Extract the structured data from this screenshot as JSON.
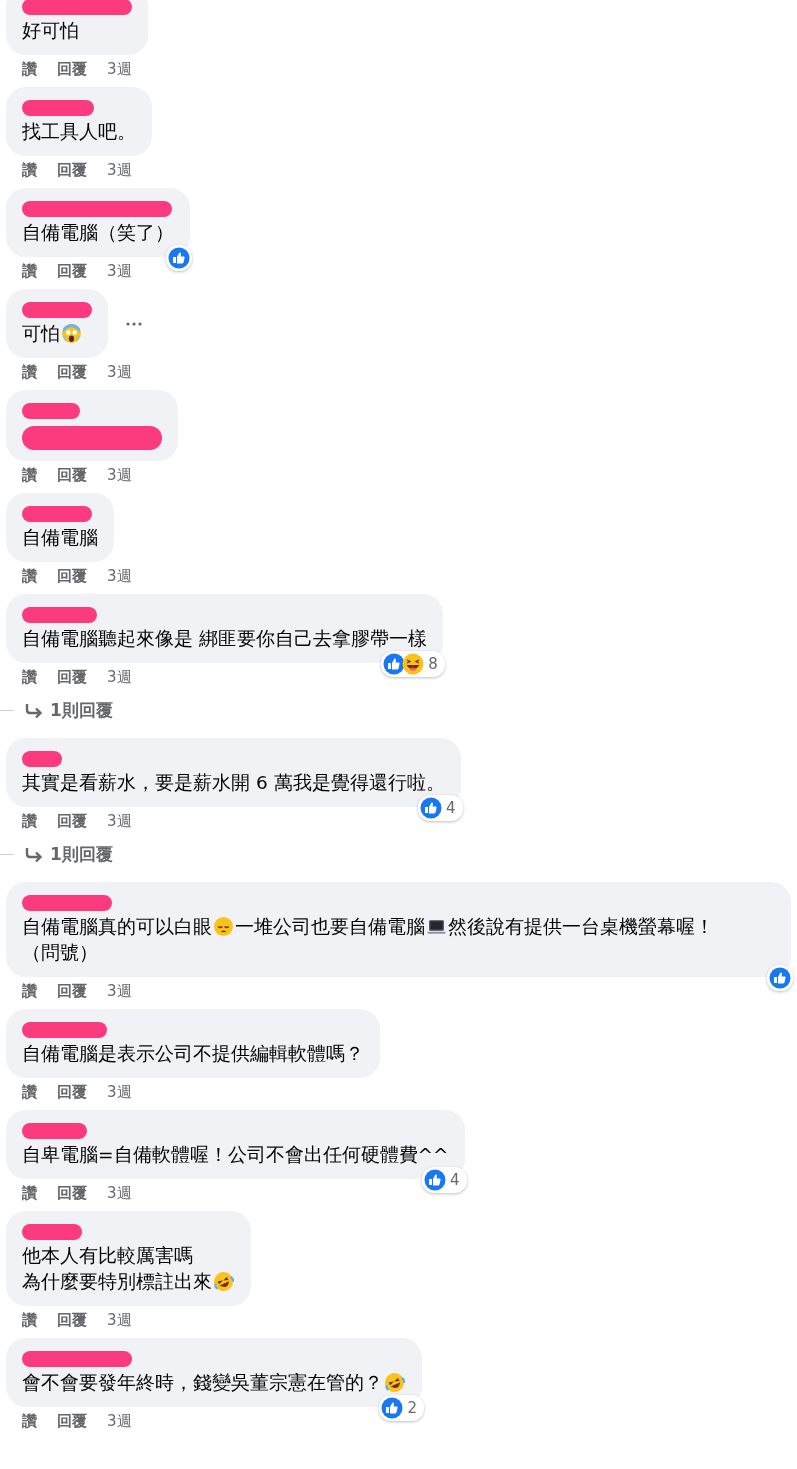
{
  "comments": [
    {
      "parts": [
        {
          "kind": "text",
          "text": "好可怕"
        }
      ],
      "like_label": "讚",
      "reply_label": "回覆",
      "time": "3週"
    },
    {
      "parts": [
        {
          "kind": "text",
          "text": "找工具人吧。"
        }
      ],
      "like_label": "讚",
      "reply_label": "回覆",
      "time": "3週"
    },
    {
      "parts": [
        {
          "kind": "text",
          "text": "自備電腦（笑了）"
        }
      ],
      "reactions": {
        "types": [
          {
            "kind": "like"
          }
        ]
      },
      "like_label": "讚",
      "reply_label": "回覆",
      "time": "3週"
    },
    {
      "parts": [
        {
          "kind": "text",
          "text": "可怕"
        },
        {
          "kind": "scream"
        }
      ],
      "menu_button": true,
      "like_label": "讚",
      "reply_label": "回覆",
      "time": "3週"
    },
    {
      "body_redacted": true,
      "like_label": "讚",
      "reply_label": "回覆",
      "time": "3週"
    },
    {
      "parts": [
        {
          "kind": "text",
          "text": "自備電腦"
        }
      ],
      "like_label": "讚",
      "reply_label": "回覆",
      "time": "3週"
    },
    {
      "parts": [
        {
          "kind": "text",
          "text": "自備電腦聽起來像是 綁匪要你自己去拿膠帶一樣"
        }
      ],
      "reactions": {
        "types": [
          {
            "kind": "like"
          },
          {
            "kind": "haha"
          }
        ],
        "count": "8"
      },
      "like_label": "讚",
      "reply_label": "回覆",
      "time": "3週",
      "replies_link": "1則回覆"
    },
    {
      "parts": [
        {
          "kind": "text",
          "text": "其實是看薪水，要是薪水開 6 萬我是覺得還行啦。"
        }
      ],
      "reactions": {
        "types": [
          {
            "kind": "like"
          }
        ],
        "count": "4"
      },
      "like_label": "讚",
      "reply_label": "回覆",
      "time": "3週",
      "replies_link": "1則回覆"
    },
    {
      "parts": [
        {
          "kind": "text",
          "text": "自備電腦真的可以白眼"
        },
        {
          "kind": "pensive"
        },
        {
          "kind": "text",
          "text": "一堆公司也要自備電腦"
        },
        {
          "kind": "laptop"
        },
        {
          "kind": "text",
          "text": "然後說有提供一台桌機螢幕喔！（問號）"
        }
      ],
      "reactions": {
        "types": [
          {
            "kind": "like"
          }
        ]
      },
      "like_label": "讚",
      "reply_label": "回覆",
      "time": "3週"
    },
    {
      "parts": [
        {
          "kind": "text",
          "text": "自備電腦是表示公司不提供編輯軟體嗎？"
        }
      ],
      "like_label": "讚",
      "reply_label": "回覆",
      "time": "3週"
    },
    {
      "parts": [
        {
          "kind": "text",
          "text": "自卑電腦=自備軟體喔！公司不會出任何硬體費^^"
        }
      ],
      "reactions": {
        "types": [
          {
            "kind": "like"
          }
        ],
        "count": "4"
      },
      "like_label": "讚",
      "reply_label": "回覆",
      "time": "3週"
    },
    {
      "parts": [
        {
          "kind": "text",
          "text": "他本人有比較厲害嗎"
        },
        {
          "kind": "break"
        },
        {
          "kind": "text",
          "text": "為什麼要特別標註出來"
        },
        {
          "kind": "rofl"
        }
      ],
      "like_label": "讚",
      "reply_label": "回覆",
      "time": "3週"
    },
    {
      "parts": [
        {
          "kind": "text",
          "text": "會不會要發年終時，錢變吳董宗憲在管的？"
        },
        {
          "kind": "rofl"
        }
      ],
      "reactions": {
        "types": [
          {
            "kind": "like"
          }
        ],
        "count": "2"
      },
      "like_label": "讚",
      "reply_label": "回覆",
      "time": "3週"
    }
  ]
}
